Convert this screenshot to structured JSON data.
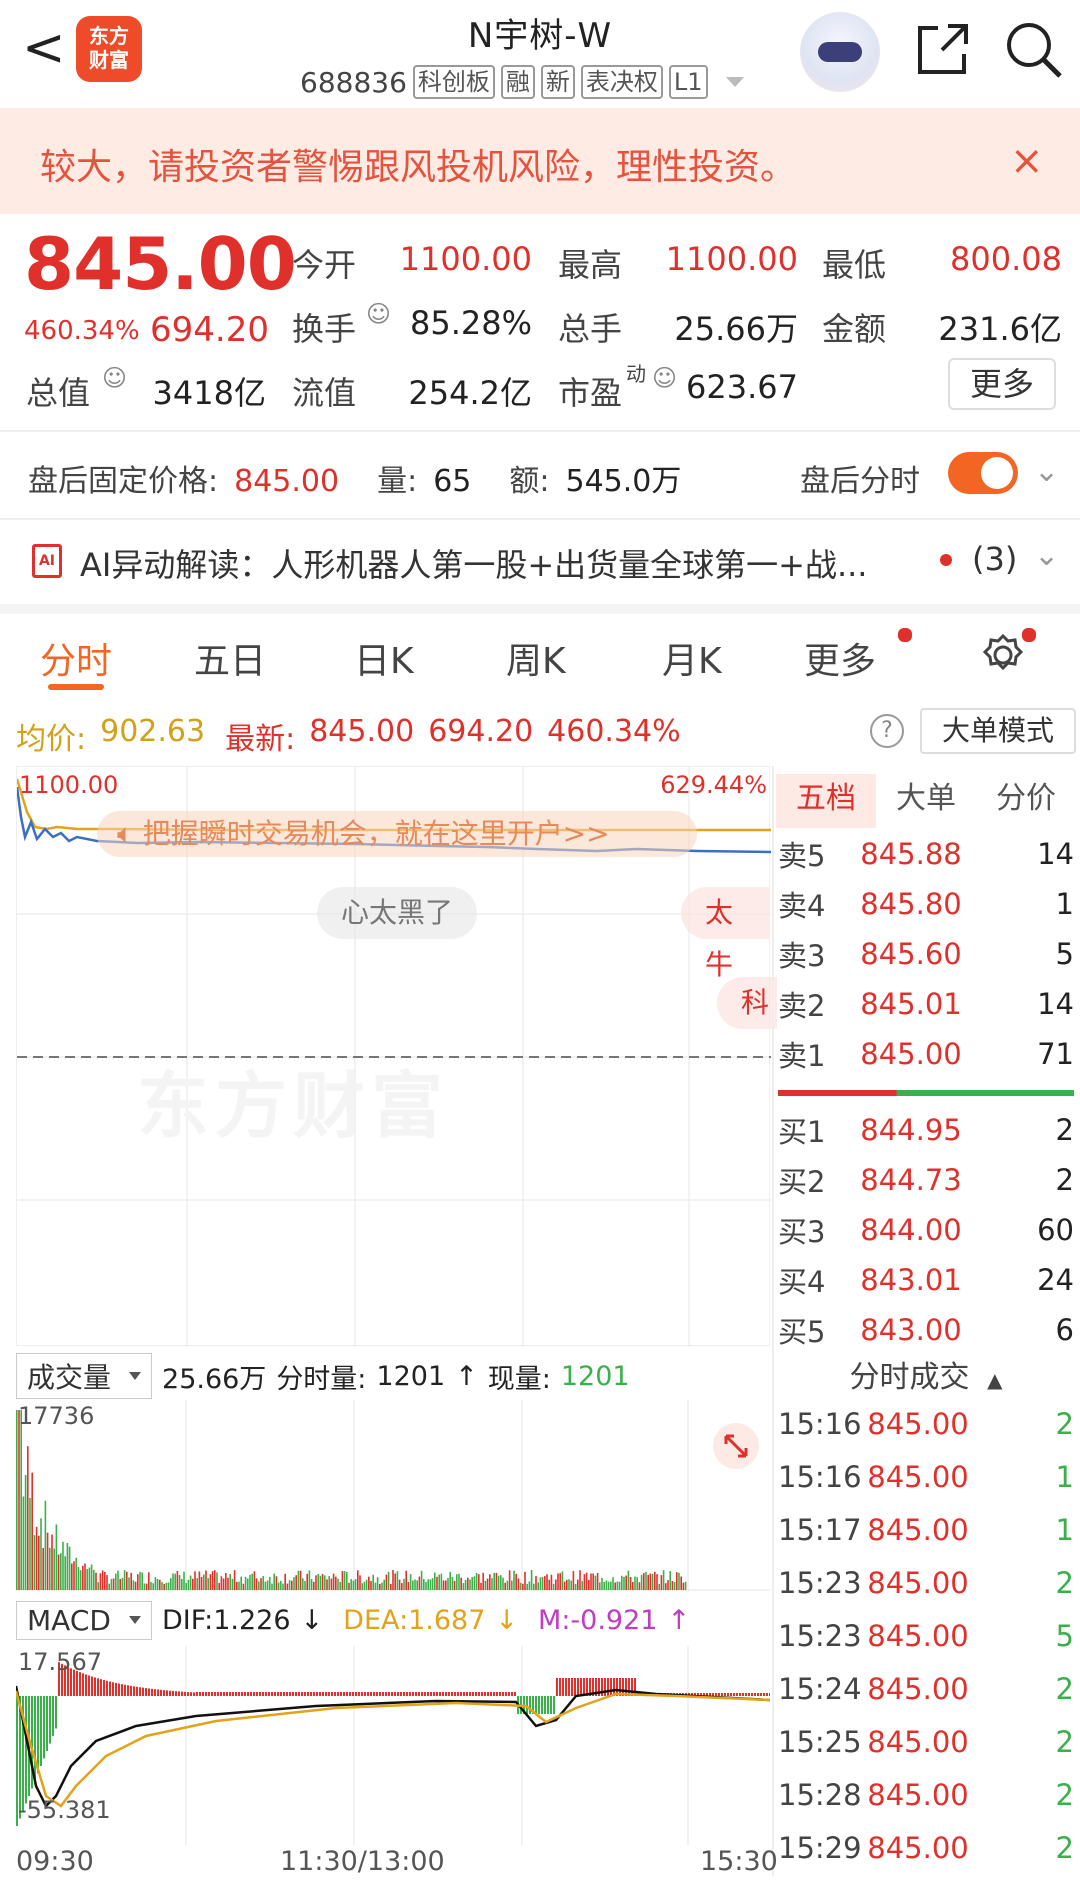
{
  "header": {
    "back": "<",
    "logo": "东方\n财富",
    "title": "N宇树-W",
    "code": "688836",
    "tags": [
      "科创板",
      "融",
      "新",
      "表决权",
      "L1"
    ]
  },
  "warning": {
    "text": "较大，请投资者警惕跟风投机风险，理性投资。",
    "close": "×"
  },
  "quote": {
    "price": "845.00",
    "change_pct": "460.34%",
    "change": "694.20",
    "open_label": "今开",
    "open": "1100.00",
    "high_label": "最高",
    "high": "1100.00",
    "low_label": "最低",
    "low": "800.08",
    "turnover_label": "换手",
    "turnover": "85.28%",
    "volume_label": "总手",
    "volume": "25.66万",
    "amount_label": "金额",
    "amount": "231.6亿",
    "mktcap_label": "总值",
    "mktcap": "3418亿",
    "float_label": "流值",
    "float": "254.2亿",
    "pe_label": "市盈",
    "pe_sup": "动",
    "pe": "623.67",
    "more": "更多"
  },
  "after_hours": {
    "label": "盘后固定价格:",
    "price": "845.00",
    "vol_label": "量:",
    "vol": "65",
    "amt_label": "额:",
    "amt": "545.0万",
    "toggle_label": "盘后分时"
  },
  "ai": {
    "icon": "AI",
    "text": "AI异动解读：人形机器人第一股+出货量全球第一+战...",
    "count": "(3)"
  },
  "tabs": [
    "分时",
    "五日",
    "日K",
    "周K",
    "月K",
    "更多"
  ],
  "info": {
    "avg_label": "均价:",
    "avg": "902.63",
    "latest_label": "最新:",
    "latest": "845.00",
    "chg": "694.20",
    "pct": "460.34%",
    "big_mode": "大单模式"
  },
  "chart": {
    "top_price": "1100.00",
    "top_pct": "629.44%",
    "banner": "把握瞬时交易机会，就在这里开户>>",
    "danmu1": "心太黑了",
    "danmu2": "太牛",
    "danmu3": "科",
    "watermark": "东方财富"
  },
  "orderbook": {
    "tabs": [
      "五档",
      "大单",
      "分价"
    ],
    "asks": [
      {
        "label": "卖5",
        "price": "845.88",
        "vol": "14"
      },
      {
        "label": "卖4",
        "price": "845.80",
        "vol": "1"
      },
      {
        "label": "卖3",
        "price": "845.60",
        "vol": "5"
      },
      {
        "label": "卖2",
        "price": "845.01",
        "vol": "14"
      },
      {
        "label": "卖1",
        "price": "845.00",
        "vol": "71"
      }
    ],
    "bids": [
      {
        "label": "买1",
        "price": "844.95",
        "vol": "2"
      },
      {
        "label": "买2",
        "price": "844.73",
        "vol": "2"
      },
      {
        "label": "买3",
        "price": "844.00",
        "vol": "60"
      },
      {
        "label": "买4",
        "price": "843.01",
        "vol": "24"
      },
      {
        "label": "买5",
        "price": "843.00",
        "vol": "6"
      }
    ]
  },
  "volume": {
    "select": "成交量",
    "total": "25.66万",
    "tick_label": "分时量:",
    "tick": "1201",
    "arrow": "↑",
    "now_label": "现量:",
    "now": "1201",
    "max": "17736"
  },
  "macd": {
    "select": "MACD",
    "dif": "DIF:1.226",
    "dif_arrow": "↓",
    "dea": "DEA:1.687",
    "dea_arrow": "↓",
    "m": "M:-0.921",
    "m_arrow": "↑",
    "top": "17.567",
    "bottom": "-55.381"
  },
  "xaxis": [
    "09:30",
    "11:30/13:00",
    "15:30"
  ],
  "trades": {
    "title": "分时成交",
    "rows": [
      {
        "time": "15:16",
        "price": "845.00",
        "vol": "2"
      },
      {
        "time": "15:16",
        "price": "845.00",
        "vol": "1"
      },
      {
        "time": "15:17",
        "price": "845.00",
        "vol": "1"
      },
      {
        "time": "15:23",
        "price": "845.00",
        "vol": "2"
      },
      {
        "time": "15:23",
        "price": "845.00",
        "vol": "5"
      },
      {
        "time": "15:24",
        "price": "845.00",
        "vol": "2"
      },
      {
        "time": "15:25",
        "price": "845.00",
        "vol": "2"
      },
      {
        "time": "15:28",
        "price": "845.00",
        "vol": "2"
      },
      {
        "time": "15:29",
        "price": "845.00",
        "vol": "2"
      }
    ]
  },
  "colors": {
    "up": "#e0302b",
    "down": "#3bb04a",
    "accent": "#f26522",
    "avg": "#e3a21a",
    "price_line": "#3a6fc4"
  }
}
